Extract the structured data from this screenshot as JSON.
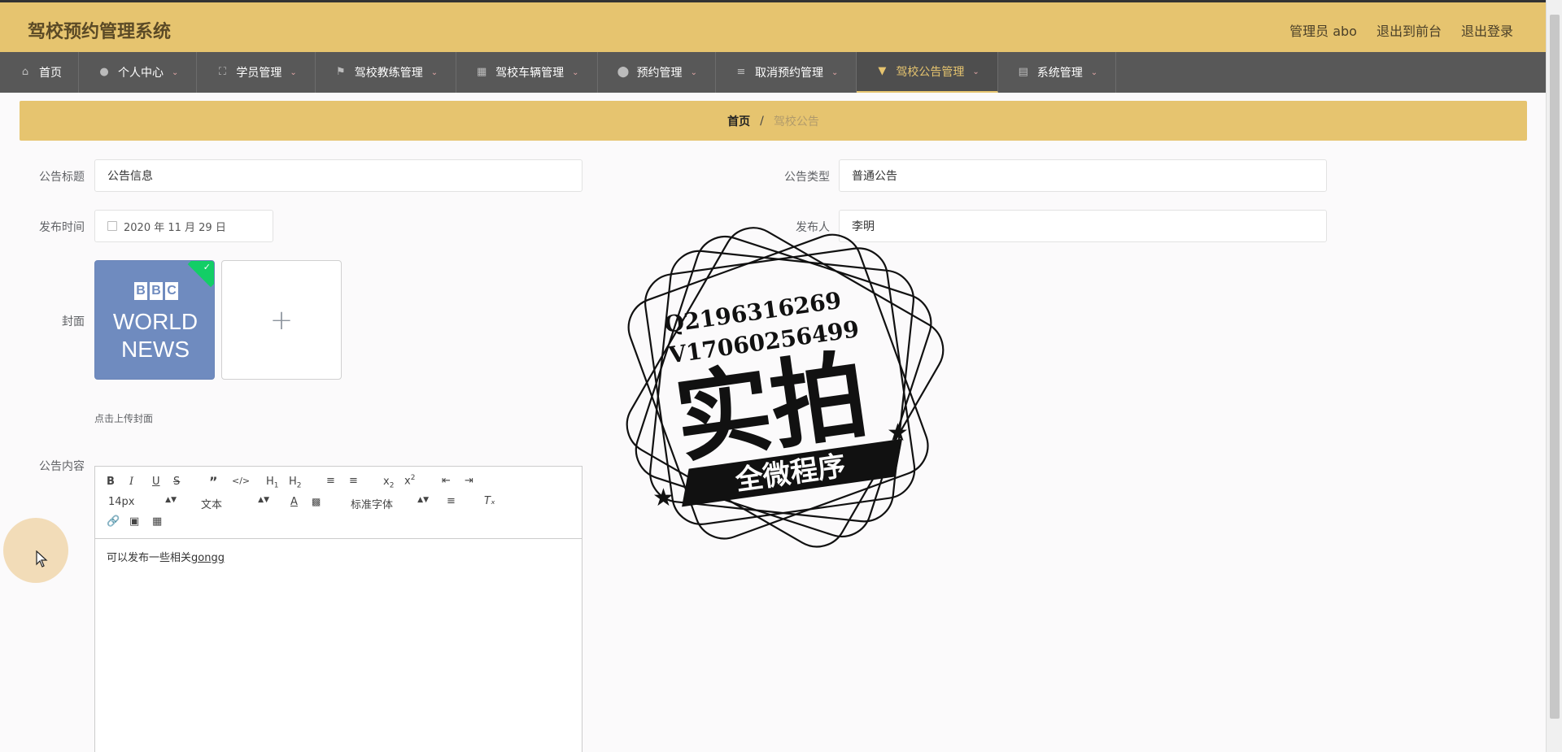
{
  "app": {
    "title": "驾校预约管理系统",
    "header_links": [
      "管理员 abo",
      "退出到前台",
      "退出登录"
    ]
  },
  "nav": {
    "items": [
      {
        "label": "首页",
        "icon": "home-icon",
        "caret": false,
        "active": false
      },
      {
        "label": "个人中心",
        "icon": "user-icon",
        "caret": true,
        "active": false
      },
      {
        "label": "学员管理",
        "icon": "expand-icon",
        "caret": true,
        "active": false
      },
      {
        "label": "驾校教练管理",
        "icon": "flag-icon",
        "caret": true,
        "active": false
      },
      {
        "label": "驾校车辆管理",
        "icon": "clipboard-icon",
        "caret": true,
        "active": false
      },
      {
        "label": "预约管理",
        "icon": "map-pin-icon",
        "caret": true,
        "active": false
      },
      {
        "label": "取消预约管理",
        "icon": "sliders-icon",
        "caret": true,
        "active": false
      },
      {
        "label": "驾校公告管理",
        "icon": "bullhorn-icon",
        "caret": true,
        "active": true
      },
      {
        "label": "系统管理",
        "icon": "chart-icon",
        "caret": true,
        "active": false
      }
    ]
  },
  "breadcrumb": {
    "home": "首页",
    "separator": "/",
    "current": "驾校公告"
  },
  "form": {
    "title_label": "公告标题",
    "title_value": "公告信息",
    "type_label": "公告类型",
    "type_value": "普通公告",
    "time_label": "发布时间",
    "time_value": "2020 年 11 月 29 日",
    "publisher_label": "发布人",
    "publisher_value": "李明",
    "cover_label": "封面",
    "cover_hint": "点击上传封面",
    "upload_plus": "+",
    "content_label": "公告内容"
  },
  "cover_image": {
    "bbc_letters": [
      "B",
      "B",
      "C"
    ],
    "line1": "WORLD",
    "line2": "NEWS"
  },
  "editor": {
    "font_size": "14px",
    "heading_select": "文本",
    "font_family_select": "标准字体",
    "content_prefix": "可以发布一些相关",
    "content_underlined": "gongg"
  },
  "watermark": {
    "line1": "Q2196316269",
    "line2": "V17060256499",
    "big_text": "实拍",
    "ribbon_text": "全微程序"
  },
  "colors": {
    "header_bg": "#e6c46f",
    "nav_bg": "#585858",
    "active_accent": "#e6c46f",
    "success_badge": "#13ce66"
  }
}
